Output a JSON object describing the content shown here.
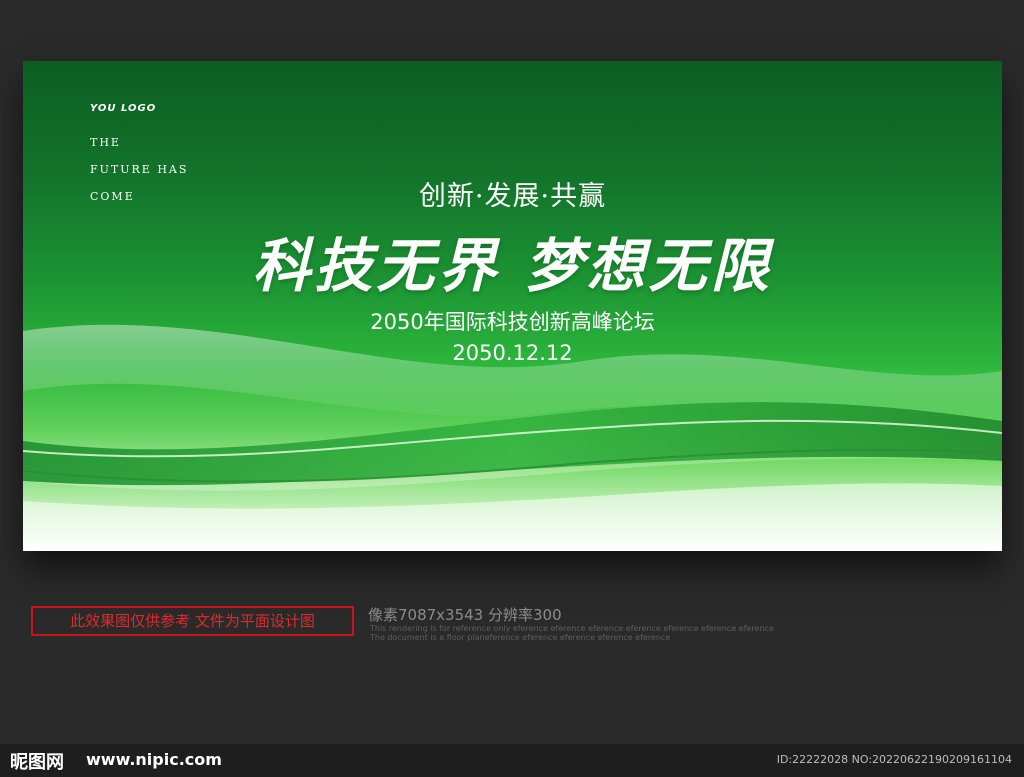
{
  "banner": {
    "logo": "YOU LOGO",
    "tagline": [
      "THE",
      "FUTURE HAS",
      "COME"
    ],
    "slogan": "创新·发展·共赢",
    "headline": "科技无界  梦想无限",
    "subtitle": "2050年国际科技创新高峰论坛",
    "date": "2050.12.12"
  },
  "notice": "此效果图仅供参考 文件为平面设计图",
  "resolution": {
    "text": "像素7087x3543 分辨率300",
    "note_line1": "This rendering is for reference only  eference eference eference eference eference eference eference",
    "note_line2": "The document is a floor planeference eference eference eference eference"
  },
  "footer": {
    "logo_text": "昵图网",
    "url": "www.nipic.com",
    "image_id": "ID:22222028 NO:20220622190209161104"
  },
  "colors": {
    "background": "#2a2a2a",
    "banner_dark_green": "#0b5e22",
    "banner_green": "#2db63c",
    "notice_red": "#c8151c"
  }
}
